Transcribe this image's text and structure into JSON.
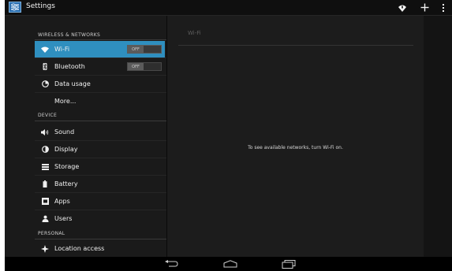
{
  "action_bar": {
    "title": "Settings",
    "actions": [
      "wifi-add-icon",
      "plus-icon",
      "overflow-menu-icon"
    ]
  },
  "sidebar": {
    "sections": [
      {
        "header": "WIRELESS & NETWORKS",
        "items": [
          {
            "label": "Wi-Fi",
            "icon": "wifi-icon",
            "selected": true,
            "toggle": "OFF"
          },
          {
            "label": "Bluetooth",
            "icon": "bluetooth-icon",
            "toggle": "OFF"
          },
          {
            "label": "Data usage",
            "icon": "data-usage-icon"
          },
          {
            "label": "More..."
          }
        ]
      },
      {
        "header": "DEVICE",
        "items": [
          {
            "label": "Sound",
            "icon": "sound-icon"
          },
          {
            "label": "Display",
            "icon": "display-icon"
          },
          {
            "label": "Storage",
            "icon": "storage-icon"
          },
          {
            "label": "Battery",
            "icon": "battery-icon"
          },
          {
            "label": "Apps",
            "icon": "apps-icon"
          },
          {
            "label": "Users",
            "icon": "users-icon"
          }
        ]
      },
      {
        "header": "PERSONAL",
        "items": [
          {
            "label": "Location access",
            "icon": "location-icon"
          }
        ]
      }
    ]
  },
  "detail": {
    "header": "Wi-Fi",
    "message": "To see available networks, turn Wi-Fi on."
  },
  "nav_bar": {
    "buttons": [
      "back-icon",
      "home-icon",
      "recent-apps-icon"
    ]
  },
  "colors": {
    "accent": "#2f8fbf",
    "background": "#161616"
  }
}
